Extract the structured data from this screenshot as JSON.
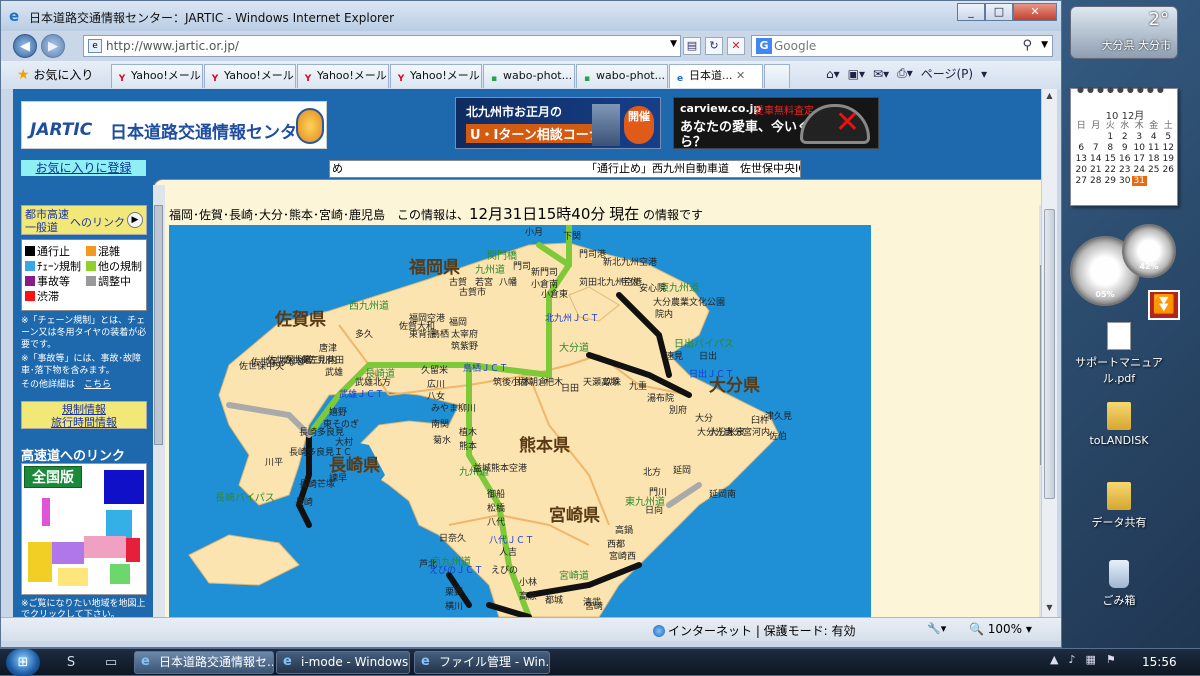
{
  "browser": {
    "window_title": "日本道路交通情報センター：JARTIC - Windows Internet Explorer",
    "address": "http://www.jartic.or.jp/",
    "search_placeholder": "Google",
    "favorites_label": "お気に入り",
    "tabs": [
      {
        "label": "Yahoo!メール",
        "icon": "yahoo-y"
      },
      {
        "label": "Yahoo!メール",
        "icon": "yahoo-y"
      },
      {
        "label": "Yahoo!メール",
        "icon": "yahoo-y"
      },
      {
        "label": "Yahoo!メール",
        "icon": "yahoo-y"
      },
      {
        "label": "wabo-phot...",
        "icon": "green-page"
      },
      {
        "label": "wabo-phot...",
        "icon": "green-page"
      },
      {
        "label": "日本道...",
        "icon": "ie"
      }
    ],
    "page_menu": "ページ(P)",
    "status": {
      "zone": "インターネット | 保護モード: 有効",
      "zoom": "100%"
    }
  },
  "site": {
    "logo_en": "JARTIC",
    "logo_jp": "日本道路交通情報センター",
    "ad1": {
      "line1": "北九州市お正月の",
      "line2": "U・Iターン相談コーナー",
      "badge": "開催"
    },
    "ad2": {
      "brand": "carview.co.jp",
      "note": "愛車無料査定",
      "line": "あなたの愛車、今いくら？"
    },
    "fav_register": "お気に入りに登録",
    "ticker_left": "め",
    "ticker_right": "「通行止め」西九州自動車道　佐世保中央IC",
    "toshi_link": {
      "line1": "都市高速",
      "line2": "一般道",
      "suffix": "へのリンク"
    },
    "legend": [
      {
        "label": "通行止",
        "color": "#000000"
      },
      {
        "label": "混雑",
        "color": "#f39a1e"
      },
      {
        "label": "ﾁｪｰﾝ規制",
        "color": "#3aa6e8"
      },
      {
        "label": "他の規制",
        "color": "#8fd12a"
      },
      {
        "label": "事故等",
        "color": "#8a1a8a"
      },
      {
        "label": "調整中",
        "color": "#999999"
      },
      {
        "label": "渋滞",
        "color": "#ff1010"
      }
    ],
    "note1": "※「チェーン規制」とは、チェーン又は冬用タイヤの装着が必要です。",
    "note2": "※「事故等」には、事故･故障車･落下物を含みます。",
    "note3a": "その他詳細は",
    "note3b": "こちら",
    "kisei": {
      "line1": "規制情報",
      "line2": "旅行時間情報"
    },
    "hwy_link": "高速道へのリンク",
    "nation_label": "全国版",
    "note_bottom": "※ご覧になりたい地域を地図上でクリックして下さい。",
    "info": {
      "prefix": "福岡･佐賀･長崎･大分･熊本･宮崎･鹿児島　この情報は、",
      "datetime": "12月31日15時40分",
      "now": "現在",
      "suffix": "の情報です"
    }
  },
  "map": {
    "prefectures": [
      "福岡県",
      "佐賀県",
      "長崎県",
      "大分県",
      "熊本県",
      "宮崎県"
    ],
    "roads": [
      "九州道",
      "西九州道",
      "長崎道",
      "東九州道",
      "大分道",
      "日出バイパス",
      "長崎バイパス",
      "南九州道",
      "宮崎道",
      "関門橋",
      "東九州道",
      "九州道"
    ],
    "junctions": [
      "武雄ＪＣＴ",
      "鳥栖ＪＣＴ",
      "北九州ＪＣＴ",
      "日出ＪＣＴ",
      "八代ＪＣＴ",
      "えびのＪＣＴ"
    ],
    "places": [
      "小月",
      "下関",
      "門司港",
      "新北九州空港",
      "門司",
      "新門司",
      "小倉南",
      "古賀",
      "若宮",
      "八幡",
      "小倉東",
      "苅田北九州空港",
      "宇佐",
      "安心院",
      "大分農業文化公園",
      "福岡空港",
      "福岡",
      "太宰府",
      "筑紫野",
      "東背振",
      "鳥栖",
      "佐賀大和",
      "多久",
      "武雄北方",
      "嬉野",
      "東そのぎ",
      "大村",
      "諫早",
      "長崎多良見",
      "長崎芒塚",
      "長崎",
      "佐世保中央",
      "佐世保みなと",
      "佐世保大塔",
      "佐世保三川内",
      "波佐見有田",
      "唐津",
      "武雄",
      "久留米",
      "広川",
      "八女",
      "みやま柳川",
      "南関",
      "菊水",
      "植木",
      "熊本",
      "益城熊本空港",
      "御船",
      "松橋",
      "八代",
      "日奈久",
      "芦北",
      "人吉",
      "えびの",
      "栗野",
      "横川",
      "小林",
      "高原",
      "都城",
      "清武",
      "宮崎西",
      "西都",
      "高鍋",
      "宮崎",
      "日向",
      "門川",
      "北方",
      "延岡",
      "延岡南",
      "筑後小郡",
      "甘木",
      "朝倉",
      "杷木",
      "日田",
      "天瀬高塚",
      "玖珠",
      "九重",
      "湯布院",
      "別府",
      "大分",
      "大分光吉",
      "大分米良",
      "大分宮河内",
      "臼杵",
      "津久見",
      "佐伯",
      "速見",
      "日出",
      "院内",
      "川平",
      "長崎多良見ＩＣ",
      "古賀市"
    ]
  },
  "desktop": {
    "weather_temp": "2°",
    "weather_city": "大分県 大分市",
    "calendar_month": "10 12月",
    "calendar_days": [
      "日",
      "月",
      "火",
      "水",
      "木",
      "金",
      "土"
    ],
    "calendar_dates": [
      "",
      "",
      "1",
      "2",
      "3",
      "4",
      "5",
      "6",
      "7",
      "8",
      "9",
      "10",
      "11",
      "12",
      "13",
      "14",
      "15",
      "16",
      "17",
      "18",
      "19",
      "20",
      "21",
      "22",
      "23",
      "24",
      "25",
      "26",
      "27",
      "28",
      "29",
      "30",
      "31",
      ""
    ],
    "gauge1": "05%",
    "gauge2": "42%",
    "icons": [
      "サポートマニュアル.pdf",
      "toLANDISK",
      "データ共有",
      "ごみ箱"
    ]
  },
  "taskbar": {
    "buttons": [
      "日本道路交通情報セ...",
      "i-mode - Windows...",
      "ファイル管理 - Win..."
    ],
    "clock": "15:56"
  }
}
